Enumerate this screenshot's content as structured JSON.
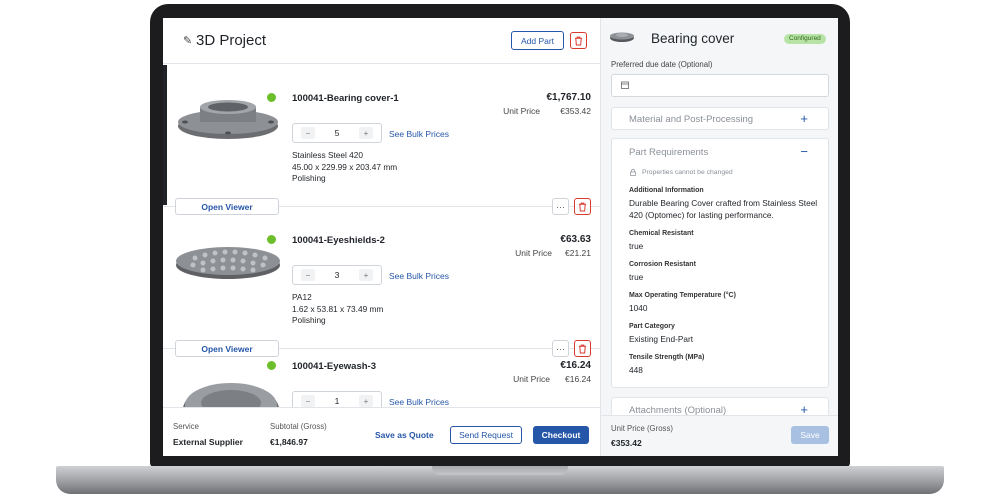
{
  "project": {
    "title": "3D Project",
    "add_part_label": "Add Part"
  },
  "items": [
    {
      "name": "100041-Bearing cover-1",
      "price": "€1,767.10",
      "unit_price_label": "Unit Price",
      "unit_price": "€353.42",
      "quantity": "5",
      "bulk_label": "See Bulk Prices",
      "material": "Stainless Steel 420",
      "dimensions": "45.00 x 229.99 x 203.47 mm",
      "finish": "Polishing",
      "viewer_label": "Open Viewer",
      "status_color": "#6cbf2a"
    },
    {
      "name": "100041-Eyeshields-2",
      "price": "€63.63",
      "unit_price_label": "Unit Price",
      "unit_price": "€21.21",
      "quantity": "3",
      "bulk_label": "See Bulk Prices",
      "material": "PA12",
      "dimensions": "1.62 x 53.81 x 73.49 mm",
      "finish": "Polishing",
      "viewer_label": "Open Viewer",
      "status_color": "#6cbf2a"
    },
    {
      "name": "100041-Eyewash-3",
      "price": "€16.24",
      "unit_price_label": "Unit Price",
      "unit_price": "€16.24",
      "quantity": "1",
      "bulk_label": "See Bulk Prices",
      "status_color": "#6cbf2a"
    }
  ],
  "footer": {
    "service_label": "Service",
    "service_value": "External Supplier",
    "subtotal_label": "Subtotal (Gross)",
    "subtotal_value": "€1,846.97",
    "save_quote_label": "Save as Quote",
    "send_request_label": "Send Request",
    "checkout_label": "Checkout"
  },
  "detail": {
    "title": "Bearing cover",
    "badge": "Configured",
    "due_date_label": "Preferred due date (Optional)",
    "due_date_value": "",
    "material_panel_title": "Material and Post-Processing",
    "requirements_panel_title": "Part Requirements",
    "locked_note": "Properties cannot be changed",
    "requirements": [
      {
        "label": "Additional Information",
        "value": "Durable Bearing Cover crafted from Stainless Steel 420 (Optomec) for lasting performance."
      },
      {
        "label": "Chemical Resistant",
        "value": "true"
      },
      {
        "label": "Corrosion Resistant",
        "value": "true"
      },
      {
        "label": "Max Operating Temperature (°C)",
        "value": "1040"
      },
      {
        "label": "Part Category",
        "value": "Existing End-Part"
      },
      {
        "label": "Tensile Strength (MPa)",
        "value": "448"
      }
    ],
    "attachments_panel_title": "Attachments (Optional)",
    "unit_price_label": "Unit Price (Gross)",
    "unit_price_value": "€353.42",
    "save_label": "Save"
  },
  "colors": {
    "accent": "#2556a8",
    "danger": "#d93a2e",
    "status_ok": "#6cbf2a",
    "badge_bg": "#b8e3a6"
  },
  "icons": {
    "edit": "pencil-icon",
    "delete": "trash-icon",
    "more": "ellipsis-icon",
    "expand": "plus-icon",
    "collapse": "minus-icon",
    "date": "calendar-icon",
    "lock": "lock-icon"
  }
}
